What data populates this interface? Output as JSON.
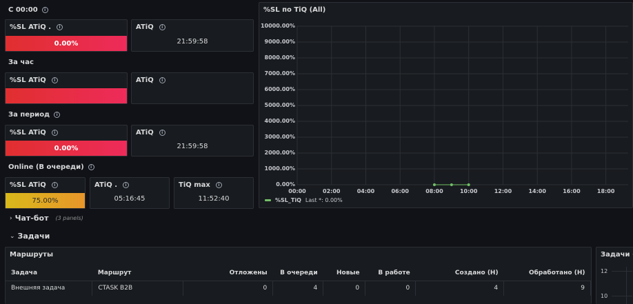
{
  "sections": {
    "since_midnight": "С 00:00",
    "per_hour": "За час",
    "per_period": "За период",
    "online": "Online (В очереди)"
  },
  "stats": {
    "row1": {
      "sl_title": "%SL ATiQ .",
      "sl_value": "0.00%",
      "atiq_title": "ATiQ",
      "atiq_value": "21:59:58"
    },
    "row2": {
      "sl_title": "%SL ATiQ",
      "atiq_title": "ATiQ"
    },
    "row3": {
      "sl_title": "%SL ATiQ",
      "sl_value": "0.00%",
      "atiq_title": "ATiQ",
      "atiq_value": "21:59:58"
    },
    "row4": {
      "sl_title": "%SL ATiQ",
      "sl_value": "75.00%",
      "atiq_title": "ATiQ .",
      "atiq_value": "05:16:45",
      "tiq_title": "TiQ max",
      "tiq_value": "11:52:40"
    }
  },
  "chart_panel": {
    "title": "%SL по TiQ (All)",
    "legend_name": "%SL_TiQ",
    "legend_last": "Last *: 0.00%"
  },
  "chart_data": {
    "type": "line",
    "title": "%SL по TiQ (All)",
    "y_ticks": [
      "0.00%",
      "1000.00%",
      "2000.00%",
      "3000.00%",
      "4000.00%",
      "5000.00%",
      "6000.00%",
      "7000.00%",
      "8000.00%",
      "9000.00%",
      "10000.00%"
    ],
    "x_ticks": [
      "00:00",
      "02:00",
      "04:00",
      "06:00",
      "08:00",
      "10:00",
      "12:00",
      "14:00",
      "16:00",
      "18:00"
    ],
    "ylim": [
      0,
      10000
    ],
    "xlim_hours": [
      0,
      19.3
    ],
    "series": [
      {
        "name": "%SL_TiQ",
        "color": "#73bf69",
        "points": [
          {
            "x": "08:00",
            "y": 0
          },
          {
            "x": "09:00",
            "y": 0
          },
          {
            "x": "10:00",
            "y": 0
          }
        ]
      }
    ],
    "grid": true,
    "legend": "bottom-left"
  },
  "collapsed_row": {
    "title": "Чат-бот",
    "meta": "(3 panels)"
  },
  "tasks_row": {
    "title": "Задачи"
  },
  "routes_panel": {
    "title": "Маршруты",
    "columns": [
      "Задача",
      "Маршрут",
      "Отложены",
      "В очереди",
      "Новые",
      "В работе",
      "Создано (Н)",
      "Обработано (Н)"
    ],
    "rows": [
      [
        "Внешняя задача",
        "CTASK B2B",
        "0",
        "4",
        "0",
        "0",
        "4",
        "9"
      ]
    ]
  },
  "side_panel": {
    "title": "Задачи (Н",
    "y_ticks": [
      "12",
      "10"
    ]
  },
  "colors": {
    "red": "#e02f2f",
    "pink": "#ee2b5a",
    "yellow": "#d8b91a",
    "green": "#73bf69",
    "bg": "#111217",
    "panel": "#181b1f"
  }
}
